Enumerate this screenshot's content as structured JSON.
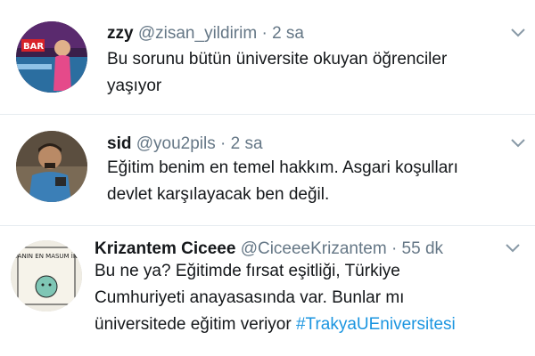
{
  "tweets": [
    {
      "name": "zzy",
      "handle": "@zisan_yildirim",
      "separator": "·",
      "time": "2 sa",
      "text_lines": [
        "Bu sorunu bütün üniversite okuyan öğrenciler",
        "yaşıyor"
      ],
      "hashtag": "",
      "avatar_text": "BAR"
    },
    {
      "name": "sid",
      "handle": "@you2pils",
      "separator": "·",
      "time": "2 sa",
      "text_lines": [
        "Eğitim benim en temel hakkım. Asgari koşulları",
        "devlet karşılayacak ben değil."
      ],
      "hashtag": "",
      "avatar_text": ""
    },
    {
      "name": "Krizantem Ciceee",
      "handle": "@CiceeeKrizantem",
      "separator": "·",
      "time": "55 dk",
      "text_lines": [
        "Bu ne ya? Eğitimde fırsat eşitliği, Türkiye",
        "Cumhuriyeti anayasasında var. Bunlar mı",
        "üniversitede eğitim veriyor "
      ],
      "hashtag": "#TrakyaUEniversitesi",
      "avatar_text": "DÜNYANIN EN MASUM İNSANI"
    }
  ],
  "colors": {
    "handle": "#657786",
    "hashtag": "#1b95e0",
    "divider": "#e6ecf0",
    "chevron": "#8899a6"
  },
  "icons": {
    "caret": "chevron-down-icon"
  }
}
